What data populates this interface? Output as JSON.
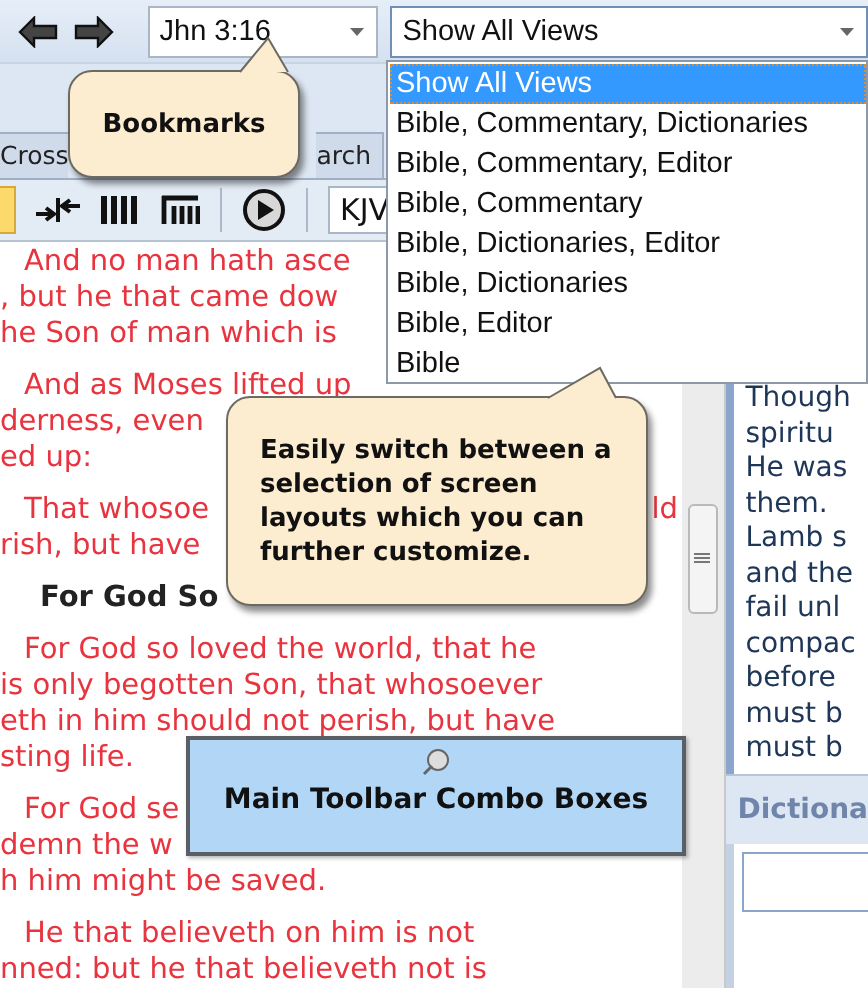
{
  "toolbar": {
    "bookmark_combo": {
      "value": "Jhn 3:16"
    },
    "view_combo": {
      "value": "Show All Views",
      "expanded": true
    }
  },
  "view_options": [
    {
      "label": "Show All Views",
      "selected": true
    },
    {
      "label": "Bible, Commentary, Dictionaries",
      "selected": false
    },
    {
      "label": "Bible, Commentary, Editor",
      "selected": false
    },
    {
      "label": "Bible, Commentary",
      "selected": false
    },
    {
      "label": "Bible, Dictionaries, Editor",
      "selected": false
    },
    {
      "label": "Bible, Dictionaries",
      "selected": false
    },
    {
      "label": "Bible, Editor",
      "selected": false
    },
    {
      "label": "Bible",
      "selected": false
    }
  ],
  "tabs": [
    {
      "label": "Cross",
      "selected": false
    },
    {
      "label": "arch",
      "selected": false
    }
  ],
  "bible_toolbar": {
    "version": "KJV"
  },
  "bible_text": [
    {
      "kind": "verse",
      "text": "And no man hath asce"
    },
    {
      "kind": "cont",
      "text": ", but he that came dow"
    },
    {
      "kind": "cont",
      "text": "he Son of man which is"
    },
    {
      "kind": "verse",
      "text": "And as Moses lifted up"
    },
    {
      "kind": "cont",
      "text": "derness, even"
    },
    {
      "kind": "cont",
      "text": "ed up:"
    },
    {
      "kind": "verse",
      "text": "That whosoe",
      "tail": "ld"
    },
    {
      "kind": "cont",
      "text": "rish, but have"
    },
    {
      "kind": "heading",
      "text": "For God So"
    },
    {
      "kind": "verse",
      "text": "For God so loved the world, that he"
    },
    {
      "kind": "cont",
      "text": "is only begotten Son, that whosoever"
    },
    {
      "kind": "cont",
      "text": "eth in him should not perish, but have"
    },
    {
      "kind": "cont",
      "text": "sting life."
    },
    {
      "kind": "verse",
      "text": "For God se"
    },
    {
      "kind": "cont",
      "text": "demn the w"
    },
    {
      "kind": "cont",
      "text": "h him might be saved."
    },
    {
      "kind": "verse",
      "text": "He that believeth on him is not"
    },
    {
      "kind": "cont",
      "text": "nned: but he that believeth not is"
    }
  ],
  "commentary": {
    "lines": [
      "Though",
      "spiritu",
      "He was",
      "them.",
      "Lamb s",
      "and the",
      "fail unl",
      "compac",
      "before",
      "must b",
      "must b"
    ]
  },
  "dictionary": {
    "title": "Dictiona"
  },
  "callouts": [
    {
      "kind": "speech",
      "text": "Bookmarks"
    },
    {
      "kind": "speech",
      "text": "Easily switch between a selection of screen layouts which you can further customize."
    },
    {
      "kind": "note",
      "text": "Main Toolbar Combo Boxes"
    }
  ]
}
